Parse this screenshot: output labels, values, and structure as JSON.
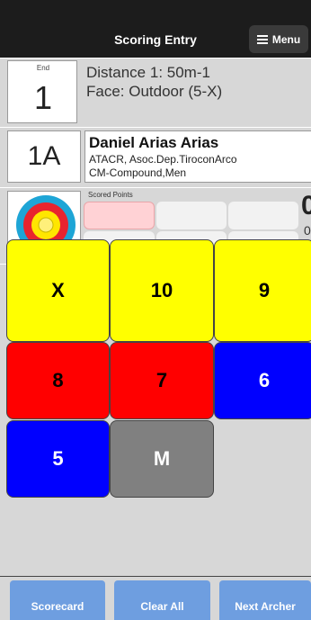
{
  "header": {
    "title": "Scoring Entry",
    "menu_label": "Menu"
  },
  "end": {
    "label": "End",
    "value": "1"
  },
  "session": {
    "distance": "Distance 1: 50m-1",
    "face": "Face: Outdoor (5-X)"
  },
  "archer": {
    "target": "1A",
    "name": "Daniel Arias Arias",
    "club": "ATACR, Asoc.Dep.TiroconArco",
    "division": "CM-Compound,Men"
  },
  "scored": {
    "label": "Scored Points",
    "total": "0",
    "sub1": "0",
    "sub2": "0",
    "cells": [
      "",
      "",
      "",
      "",
      "",
      ""
    ]
  },
  "keypad": [
    {
      "label": "X",
      "bg": "#ffff00",
      "fg": "#000000"
    },
    {
      "label": "10",
      "bg": "#ffff00",
      "fg": "#000000"
    },
    {
      "label": "9",
      "bg": "#ffff00",
      "fg": "#000000"
    },
    {
      "label": "8",
      "bg": "#ff0000",
      "fg": "#000000"
    },
    {
      "label": "7",
      "bg": "#ff0000",
      "fg": "#000000"
    },
    {
      "label": "6",
      "bg": "#0000ff",
      "fg": "#ffffff"
    },
    {
      "label": "5",
      "bg": "#0000ff",
      "fg": "#ffffff"
    },
    {
      "label": "M",
      "bg": "#808080",
      "fg": "#ffffff"
    }
  ],
  "bottom": {
    "scorecard": "Scorecard",
    "clear_all": "Clear All",
    "next_archer": "Next Archer"
  },
  "colors": {
    "topbar": "#1c1c1c",
    "button_blue": "#6e9ee0",
    "background": "#d7d7d7"
  }
}
